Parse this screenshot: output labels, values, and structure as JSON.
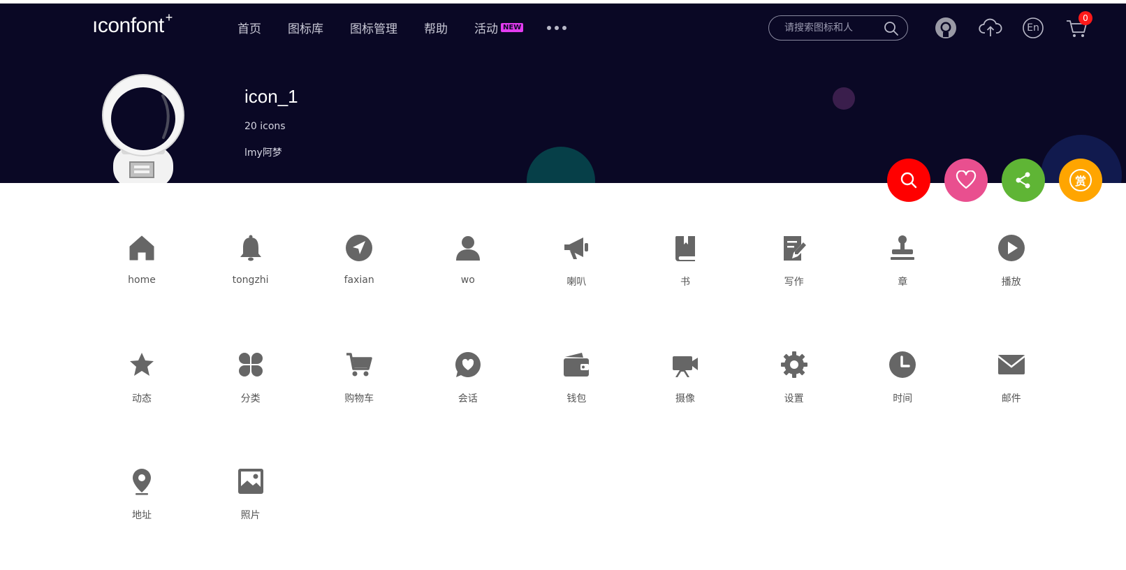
{
  "brand": {
    "logo_text": "ıconfont",
    "logo_plus": "+"
  },
  "nav": {
    "items": [
      "首页",
      "图标库",
      "图标管理",
      "帮助",
      "活动"
    ],
    "badge": "NEW"
  },
  "search": {
    "placeholder": "请搜索图标和人"
  },
  "header_icons": [
    "github-icon",
    "upload-cloud-icon",
    "language-en-icon",
    "cart-icon"
  ],
  "header": {
    "lang_label": "En",
    "cart_count": "0"
  },
  "collection": {
    "title": "icon_1",
    "count_label": "20 icons",
    "author": "lmy阿梦"
  },
  "actions": [
    {
      "name": "search-action",
      "color": "#ff0000"
    },
    {
      "name": "favorite-action",
      "color": "#e94f8f"
    },
    {
      "name": "share-action",
      "color": "#5fb535"
    },
    {
      "name": "reward-action",
      "color": "#ffa500",
      "label": "赏"
    }
  ],
  "icons": [
    {
      "label": "home",
      "icon": "home-icon"
    },
    {
      "label": "tongzhi",
      "icon": "bell-icon"
    },
    {
      "label": "faxian",
      "icon": "compass-icon"
    },
    {
      "label": "wo",
      "icon": "user-icon"
    },
    {
      "label": "喇叭",
      "icon": "megaphone-icon"
    },
    {
      "label": "书",
      "icon": "book-icon"
    },
    {
      "label": "写作",
      "icon": "edit-icon"
    },
    {
      "label": "章",
      "icon": "stamp-icon"
    },
    {
      "label": "播放",
      "icon": "play-icon"
    },
    {
      "label": "动态",
      "icon": "star-icon"
    },
    {
      "label": "分类",
      "icon": "category-icon"
    },
    {
      "label": "购物车",
      "icon": "cart-icon"
    },
    {
      "label": "会话",
      "icon": "chat-heart-icon"
    },
    {
      "label": "钱包",
      "icon": "wallet-icon"
    },
    {
      "label": "摄像",
      "icon": "video-camera-icon"
    },
    {
      "label": "设置",
      "icon": "gear-icon"
    },
    {
      "label": "时间",
      "icon": "clock-icon"
    },
    {
      "label": "邮件",
      "icon": "mail-icon"
    },
    {
      "label": "地址",
      "icon": "location-pin-icon"
    },
    {
      "label": "照片",
      "icon": "photo-icon"
    }
  ],
  "colors": {
    "header_bg": "#0a0825",
    "icon_gray": "#666666"
  }
}
